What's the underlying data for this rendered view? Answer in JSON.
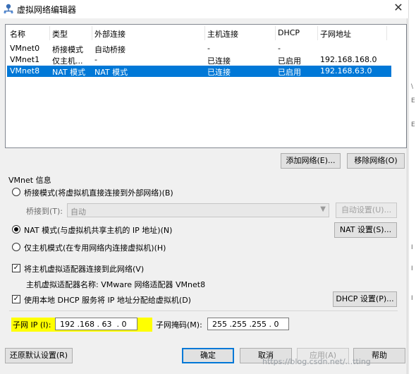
{
  "window": {
    "title": "虚拟网络编辑器",
    "close_glyph": "✕"
  },
  "table": {
    "headers": [
      "名称",
      "类型",
      "外部连接",
      "主机连接",
      "DHCP",
      "子网地址"
    ],
    "rows": [
      {
        "name": "VMnet0",
        "type": "桥接模式",
        "external": "自动桥接",
        "host": "-",
        "dhcp": "-",
        "subnet": ""
      },
      {
        "name": "VMnet1",
        "type": "仅主机...",
        "external": "-",
        "host": "已连接",
        "dhcp": "已启用",
        "subnet": "192.168.168.0"
      },
      {
        "name": "VMnet8",
        "type": "NAT 模式",
        "external": "NAT 模式",
        "host": "已连接",
        "dhcp": "已启用",
        "subnet": "192.168.63.0",
        "selected": true
      }
    ]
  },
  "buttons": {
    "add_network": "添加网络(E)...",
    "remove_network": "移除网络(O)",
    "auto_settings": "自动设置(U)...",
    "nat_settings": "NAT 设置(S)...",
    "dhcp_settings": "DHCP 设置(P)...",
    "restore_defaults": "还原默认设置(R)",
    "ok": "确定",
    "cancel": "取消",
    "apply": "应用(A)",
    "help": "帮助"
  },
  "vmnet_info": {
    "group_title": "VMnet 信息",
    "bridged_label": "桥接模式(将虚拟机直接连接到外部网络)(B)",
    "bridged_to_label": "桥接到(T):",
    "bridged_to_value": "自动",
    "nat_label": "NAT 模式(与虚拟机共享主机的 IP 地址)(N)",
    "host_only_label": "仅主机模式(在专用网络内连接虚拟机)(H)",
    "selected_mode": "nat",
    "connect_adapter_label": "将主机虚拟适配器连接到此网络(V)",
    "connect_adapter_checked": true,
    "adapter_name_label": "主机虚拟适配器名称: VMware 网络适配器 VMnet8",
    "use_dhcp_label": "使用本地 DHCP 服务将 IP 地址分配给虚拟机(D)",
    "use_dhcp_checked": true,
    "subnet_ip_label": "子网 IP (I):",
    "subnet_ip_value": "192 .168 . 63  . 0",
    "subnet_mask_label": "子网掩码(M):",
    "subnet_mask_value": "255 .255 .255 . 0"
  },
  "watermark": "https://blog.csdn.net/...tting",
  "colors": {
    "selection": "#0078d7",
    "highlight": "#ffff00"
  }
}
